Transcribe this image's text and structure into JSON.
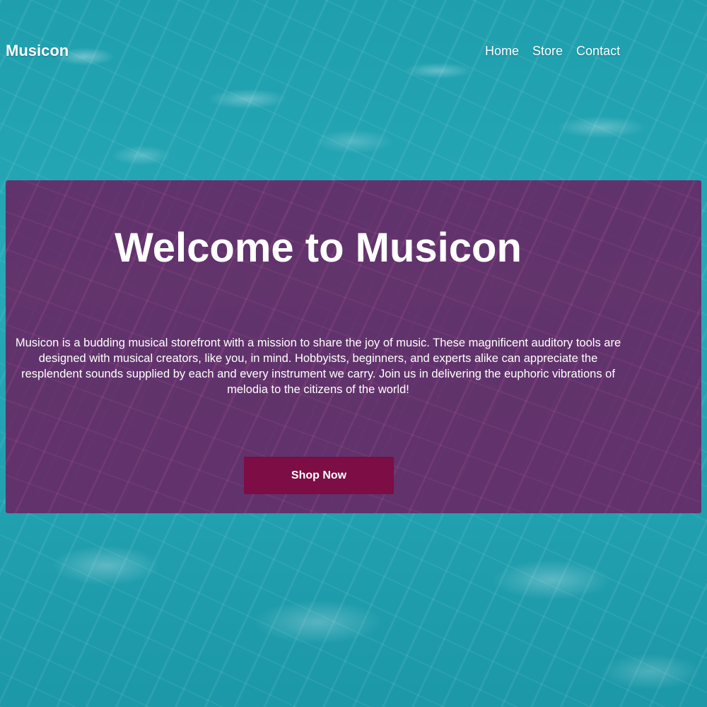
{
  "brand": {
    "name": "Musicon"
  },
  "nav": {
    "items": [
      {
        "label": "Home"
      },
      {
        "label": "Store"
      },
      {
        "label": "Contact"
      }
    ]
  },
  "hero": {
    "title": "Welcome to Musicon",
    "description": "Musicon is a budding musical storefront with a mission to share the joy of music. These magnificent auditory tools are designed with musical creators, like you, in mind. Hobbyists, beginners, and experts alike can appreciate the resplendent sounds supplied by each and every instrument we carry. Join us in delivering the euphoric vibrations of melodia to the citizens of the world!",
    "cta_label": "Shop Now"
  },
  "colors": {
    "hero_overlay": "#6f1a5c",
    "cta_background": "#7c0d45",
    "water_background": "#27a9b7",
    "text": "#ffffff"
  }
}
